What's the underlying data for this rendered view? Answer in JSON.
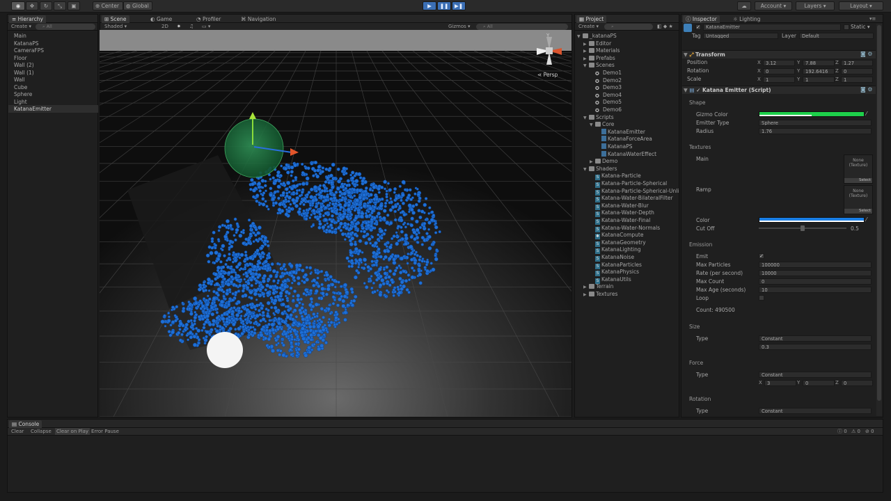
{
  "toolbar": {
    "pivot_center": "Center",
    "pivot_global": "Global",
    "account": "Account",
    "layers": "Layers",
    "layout": "Layout"
  },
  "hierarchy": {
    "tab": "Hierarchy",
    "create": "Create",
    "search_placeholder": "All",
    "items": [
      "Main",
      "KatanaPS",
      "CameraFPS",
      "Floor",
      "Wall (2)",
      "Wall (1)",
      "Wall",
      "Cube",
      "Sphere",
      "Light",
      "KatanaEmitter"
    ]
  },
  "scene_tabs": {
    "scene": "Scene",
    "game": "Game",
    "profiler": "Profiler",
    "navigation": "Navigation",
    "shaded": "Shaded",
    "mode_2d": "2D",
    "gizmos": "Gizmos",
    "search_placeholder": "All",
    "persp": "Persp"
  },
  "project": {
    "tab": "Project",
    "create": "Create",
    "tree": [
      {
        "label": "_katanaPS",
        "type": "folder",
        "indent": 0,
        "arrow": "▼"
      },
      {
        "label": "Editor",
        "type": "folder",
        "indent": 1,
        "arrow": "▶"
      },
      {
        "label": "Materials",
        "type": "folder",
        "indent": 1,
        "arrow": "▶"
      },
      {
        "label": "Prefabs",
        "type": "folder",
        "indent": 1,
        "arrow": "▶"
      },
      {
        "label": "Scenes",
        "type": "folder",
        "indent": 1,
        "arrow": "▼"
      },
      {
        "label": "Demo1",
        "type": "scene",
        "indent": 2,
        "arrow": ""
      },
      {
        "label": "Demo2",
        "type": "scene",
        "indent": 2,
        "arrow": ""
      },
      {
        "label": "Demo3",
        "type": "scene",
        "indent": 2,
        "arrow": ""
      },
      {
        "label": "Demo4",
        "type": "scene",
        "indent": 2,
        "arrow": ""
      },
      {
        "label": "Demo5",
        "type": "scene",
        "indent": 2,
        "arrow": ""
      },
      {
        "label": "Demo6",
        "type": "scene",
        "indent": 2,
        "arrow": ""
      },
      {
        "label": "Scripts",
        "type": "folder",
        "indent": 1,
        "arrow": "▼"
      },
      {
        "label": "Core",
        "type": "folder",
        "indent": 2,
        "arrow": "▼"
      },
      {
        "label": "KatanaEmitter",
        "type": "cs",
        "indent": 3,
        "arrow": ""
      },
      {
        "label": "KatanaForceArea",
        "type": "cs",
        "indent": 3,
        "arrow": ""
      },
      {
        "label": "KatanaPS",
        "type": "cs",
        "indent": 3,
        "arrow": ""
      },
      {
        "label": "KatanaWaterEffect",
        "type": "cs",
        "indent": 3,
        "arrow": ""
      },
      {
        "label": "Demo",
        "type": "folder",
        "indent": 2,
        "arrow": "▶"
      },
      {
        "label": "Shaders",
        "type": "folder",
        "indent": 1,
        "arrow": "▼"
      },
      {
        "label": "Katana-Particle",
        "type": "shader",
        "indent": 2,
        "arrow": ""
      },
      {
        "label": "Katana-Particle-Spherical",
        "type": "shader",
        "indent": 2,
        "arrow": ""
      },
      {
        "label": "Katana-Particle-Spherical-Unli",
        "type": "shader",
        "indent": 2,
        "arrow": ""
      },
      {
        "label": "Katana-Water-BilateralFilter",
        "type": "shader",
        "indent": 2,
        "arrow": ""
      },
      {
        "label": "Katana-Water-Blur",
        "type": "shader",
        "indent": 2,
        "arrow": ""
      },
      {
        "label": "Katana-Water-Depth",
        "type": "shader",
        "indent": 2,
        "arrow": ""
      },
      {
        "label": "Katana-Water-Final",
        "type": "shader",
        "indent": 2,
        "arrow": ""
      },
      {
        "label": "Katana-Water-Normals",
        "type": "shader",
        "indent": 2,
        "arrow": ""
      },
      {
        "label": "KatanaCompute",
        "type": "compute",
        "indent": 2,
        "arrow": ""
      },
      {
        "label": "KatanaGeometry",
        "type": "shader",
        "indent": 2,
        "arrow": ""
      },
      {
        "label": "KatanaLighting",
        "type": "shader",
        "indent": 2,
        "arrow": ""
      },
      {
        "label": "KatanaNoise",
        "type": "shader",
        "indent": 2,
        "arrow": ""
      },
      {
        "label": "KatanaParticles",
        "type": "shader",
        "indent": 2,
        "arrow": ""
      },
      {
        "label": "KatanaPhysics",
        "type": "shader",
        "indent": 2,
        "arrow": ""
      },
      {
        "label": "KatanaUtils",
        "type": "shader",
        "indent": 2,
        "arrow": ""
      },
      {
        "label": "Terrain",
        "type": "folder",
        "indent": 1,
        "arrow": "▶"
      },
      {
        "label": "Textures",
        "type": "folder",
        "indent": 1,
        "arrow": "▶"
      }
    ]
  },
  "inspector": {
    "tab": "Inspector",
    "lighting_tab": "Lighting",
    "object_name": "KatanaEmitter",
    "static": "Static",
    "tag_label": "Tag",
    "tag_value": "Untagged",
    "layer_label": "Layer",
    "layer_value": "Default",
    "transform": {
      "title": "Transform",
      "position_label": "Position",
      "position": {
        "x": "3.12",
        "y": "7.88",
        "z": "1.27"
      },
      "rotation_label": "Rotation",
      "rotation": {
        "x": "0",
        "y": "192.6416",
        "z": "0"
      },
      "scale_label": "Scale",
      "scale": {
        "x": "1",
        "y": "1",
        "z": "1"
      }
    },
    "emitter": {
      "title": "Katana Emitter (Script)",
      "shape_section": "Shape",
      "gizmo_color_label": "Gizmo Color",
      "gizmo_color": "#1ed04a",
      "emitter_type_label": "Emitter Type",
      "emitter_type": "Sphere",
      "radius_label": "Radius",
      "radius": "1.76",
      "textures_section": "Textures",
      "main_label": "Main",
      "ramp_label": "Ramp",
      "texture_none": "None",
      "texture_type": "(Texture)",
      "select": "Select",
      "color_label": "Color",
      "color": "#1a7fe6",
      "cutoff_label": "Cut Off",
      "cutoff": "0.5",
      "emission_section": "Emission",
      "emit_label": "Emit",
      "emit_check": "✓",
      "max_particles_label": "Max Particles",
      "max_particles": "100000",
      "rate_label": "Rate (per second)",
      "rate": "10000",
      "max_count_label": "Max Count",
      "max_count": "0",
      "max_age_label": "Max Age (seconds)",
      "max_age": "10",
      "loop_label": "Loop",
      "count": "Count: 490500",
      "size_section": "Size",
      "size_type_label": "Type",
      "size_type": "Constant",
      "size_value": "0.3",
      "force_section": "Force",
      "force_type_label": "Type",
      "force_type": "Constant",
      "force": {
        "x": "3",
        "y": "0",
        "z": "0"
      },
      "rotation_section": "Rotation",
      "rotation_type_label": "Type",
      "rotation_type": "Constant"
    }
  },
  "console": {
    "tab": "Console",
    "clear": "Clear",
    "collapse": "Collapse",
    "clear_on_play": "Clear on Play",
    "error_pause": "Error Pause",
    "info_count": "0",
    "warn_count": "0",
    "error_count": "0"
  },
  "axes": {
    "x": "X",
    "y": "Y",
    "z": "Z"
  },
  "colors": {
    "play_blue": "#3b6fb5",
    "particle_blue": "#1e6fd6",
    "gizmo_green": "#1ed04a"
  }
}
